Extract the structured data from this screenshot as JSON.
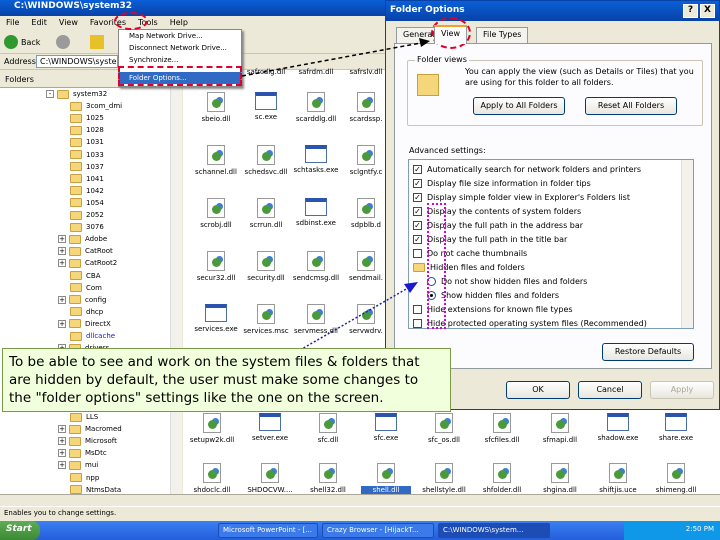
{
  "explorer": {
    "title": "C:\\WINDOWS\\system32",
    "menu": [
      "File",
      "Edit",
      "View",
      "Favorites",
      "Tools",
      "Help"
    ],
    "back": "Back",
    "address_label": "Address",
    "address": "C:\\WINDOWS\\syste",
    "folders_label": "Folders",
    "status": "Enables you to change settings."
  },
  "tools_menu": [
    "Map Network Drive...",
    "Disconnect Network Drive...",
    "Synchronize...",
    "Folder Options..."
  ],
  "tree": [
    {
      "label": "system32",
      "exp": "-"
    },
    {
      "label": "3com_dmi"
    },
    {
      "label": "1025"
    },
    {
      "label": "1028"
    },
    {
      "label": "1031"
    },
    {
      "label": "1033"
    },
    {
      "label": "1037"
    },
    {
      "label": "1041"
    },
    {
      "label": "1042"
    },
    {
      "label": "1054"
    },
    {
      "label": "2052"
    },
    {
      "label": "3076"
    },
    {
      "label": "Adobe",
      "exp": "+"
    },
    {
      "label": "CatRoot",
      "exp": "+"
    },
    {
      "label": "CatRoot2",
      "exp": "+"
    },
    {
      "label": "CBA"
    },
    {
      "label": "Com"
    },
    {
      "label": "config",
      "exp": "+"
    },
    {
      "label": "dhcp"
    },
    {
      "label": "DirectX",
      "exp": "+"
    },
    {
      "label": "dllcache"
    },
    {
      "label": "drivers",
      "exp": "+"
    }
  ],
  "tree_bottom": [
    {
      "label": "LLS"
    },
    {
      "label": "Macromed",
      "exp": "+"
    },
    {
      "label": "Microsoft",
      "exp": "+"
    },
    {
      "label": "MsDtc",
      "exp": "+"
    },
    {
      "label": "mui",
      "exp": "+"
    },
    {
      "label": "npp"
    },
    {
      "label": "NtmsData"
    }
  ],
  "files_rows": [
    [
      "safrcdlg.dll",
      "safrdm.dll",
      "safrslv.dll"
    ],
    [
      "sbeio.dll",
      "sc.exe",
      "scarddlg.dll",
      "scardssp."
    ],
    [
      "schannel.dll",
      "schedsvc.dll",
      "schtasks.exe",
      "sclgntfy.c"
    ],
    [
      "scrobj.dll",
      "scrrun.dll",
      "sdbinst.exe",
      "sdpblb.d"
    ],
    [
      "secur32.dll",
      "security.dll",
      "sendcmsg.dll",
      "sendmail."
    ],
    [
      "services.exe",
      "services.msc",
      "servmess.dll",
      "servwdrv."
    ]
  ],
  "files_bottom": [
    [
      "setupw2k.dll",
      "setver.exe",
      "sfc.dll",
      "sfc.exe",
      "sfc_os.dll",
      "sfcfiles.dll",
      "sfmapi.dll",
      "shadow.exe",
      "share.exe"
    ],
    [
      "shdoclc.dll",
      "SHDOCVW....",
      "shell32.dll",
      "shell.dll",
      "shellstyle.dll",
      "shfolder.dll",
      "shgina.dll",
      "shiftjis.uce",
      "shimeng.dll"
    ]
  ],
  "dialog": {
    "title": "Folder Options",
    "help": "?",
    "close": "X",
    "tabs": [
      "General",
      "View",
      "File Types"
    ],
    "folder_views_label": "Folder views",
    "folder_views_text": "You can apply the view (such as Details or Tiles) that you are using for this folder to all folders.",
    "apply_all": "Apply to All Folders",
    "reset_all": "Reset All Folders",
    "advanced_label": "Advanced settings:",
    "restore": "Restore Defaults",
    "ok": "OK",
    "cancel": "Cancel",
    "apply": "Apply"
  },
  "advanced": [
    {
      "t": "cb",
      "on": true,
      "label": "Automatically search for network folders and printers"
    },
    {
      "t": "cb",
      "on": true,
      "label": "Display file size information in folder tips"
    },
    {
      "t": "cb",
      "on": true,
      "label": "Display simple folder view in Explorer's Folders list"
    },
    {
      "t": "cb",
      "on": true,
      "label": "Display the contents of system folders"
    },
    {
      "t": "cb",
      "on": true,
      "label": "Display the full path in the address bar"
    },
    {
      "t": "cb",
      "on": true,
      "label": "Display the full path in the title bar"
    },
    {
      "t": "cb",
      "on": false,
      "label": "Do not cache thumbnails"
    },
    {
      "t": "folder",
      "label": "Hidden files and folders"
    },
    {
      "t": "rb",
      "on": false,
      "label": "Do not show hidden files and folders",
      "indent": true
    },
    {
      "t": "rb",
      "on": true,
      "label": "Show hidden files and folders",
      "indent": true
    },
    {
      "t": "cb",
      "on": false,
      "label": "Hide extensions for known file types"
    },
    {
      "t": "cb",
      "on": false,
      "label": "Hide protected operating system files (Recommended)"
    }
  ],
  "note": "To be able to see and work on the system files & folders that are hidden by default, the user must make some changes to the \"folder options\" settings like the one on the screen.",
  "taskbar": {
    "start": "Start",
    "tasks": [
      "Microsoft PowerPoint - [...",
      "Crazy Browser - [HijackT...",
      "C:\\WINDOWS\\system..."
    ],
    "time": "2:50 PM"
  }
}
